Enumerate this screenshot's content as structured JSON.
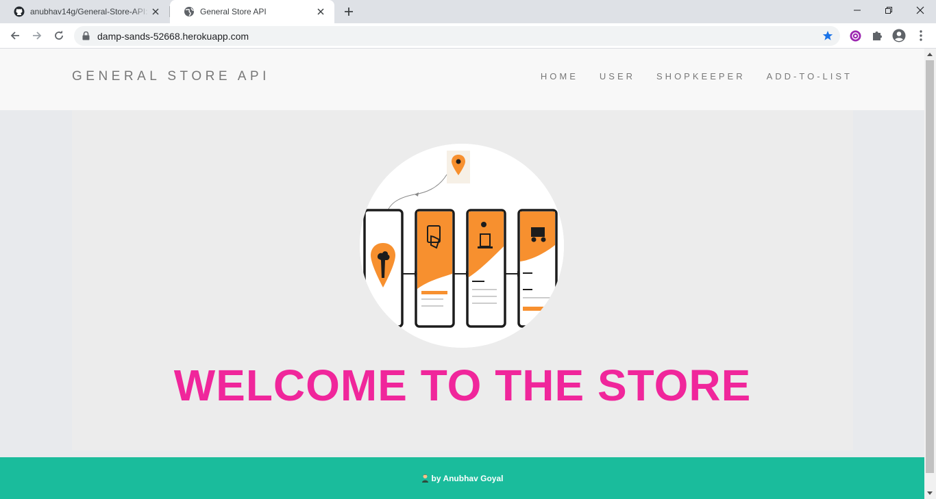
{
  "browser": {
    "tabs": [
      {
        "title": "anubhav14g/General-Store-API: ",
        "favicon": "github-icon"
      },
      {
        "title": "General Store API",
        "favicon": "globe-icon"
      }
    ],
    "url": "damp-sands-52668.herokuapp.com",
    "bookmarked": true
  },
  "site": {
    "brand": "GENERAL STORE API",
    "nav": [
      "HOME",
      "USER",
      "SHOPKEEPER",
      "ADD-TO-LIST"
    ],
    "hero_heading": "WELCOME TO THE STORE",
    "footer_text": "by Anubhav Goyal"
  },
  "colors": {
    "heading": "#f0269b",
    "footer_bg": "#1abc9c",
    "illustration_accent": "#f7902f"
  }
}
